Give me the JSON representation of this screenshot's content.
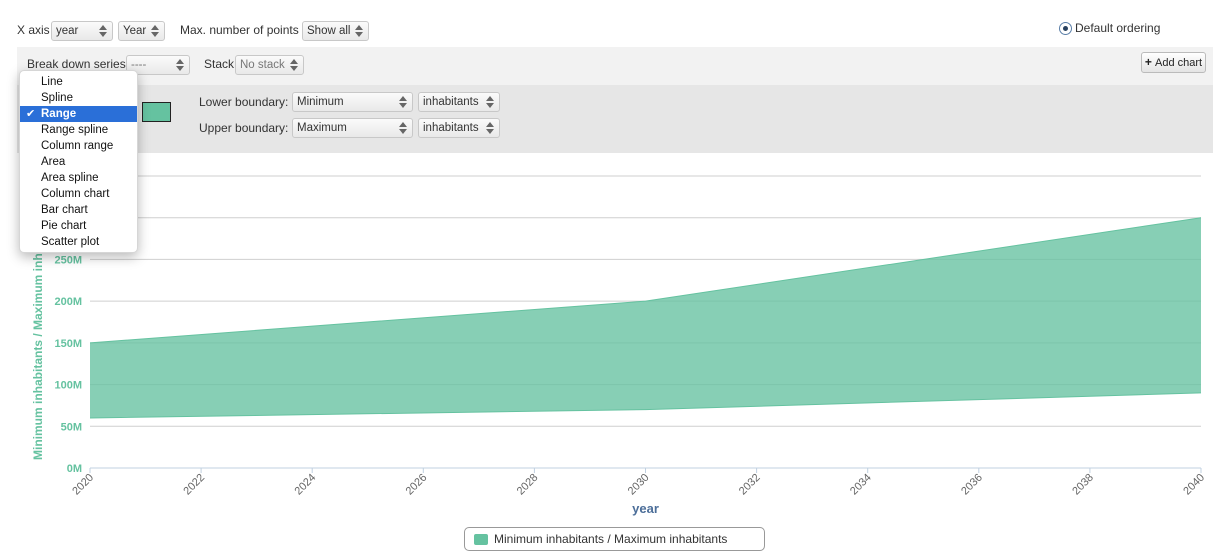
{
  "controls": {
    "x_axis_label": "X axis",
    "x_axis_value": "year",
    "x_axis_unit": "Year",
    "max_points_label": "Max. number of points",
    "max_points_value": "Show all",
    "default_ordering_label": "Default ordering",
    "break_down_label": "Break down series",
    "break_down_value": "----",
    "stack_label": "Stack",
    "stack_value": "No stack",
    "add_chart_label": "Add chart",
    "lower_boundary_label": "Lower boundary:",
    "lower_boundary_value": "Minimum",
    "lower_boundary_unit": "inhabitants",
    "upper_boundary_label": "Upper boundary:",
    "upper_boundary_value": "Maximum",
    "upper_boundary_unit": "inhabitants"
  },
  "chart_type_menu": {
    "items": [
      "Line",
      "Spline",
      "Range",
      "Range spline",
      "Column range",
      "Area",
      "Area spline",
      "Column chart",
      "Bar chart",
      "Pie chart",
      "Scatter plot"
    ],
    "selected": "Range"
  },
  "colors": {
    "series": "#65c2a0",
    "axis_title": "#65c2a0",
    "x_axis_title": "#4c6e99"
  },
  "chart_data": {
    "type": "area",
    "subtype": "range",
    "xlabel": "year",
    "ylabel": "Minimum inhabitants / Maximum inhabitants",
    "x": [
      2020,
      2030,
      2040
    ],
    "series": [
      {
        "name": "Minimum inhabitants / Maximum inhabitants",
        "low": [
          60000000,
          70000000,
          90000000
        ],
        "high": [
          150000000,
          200000000,
          300000000
        ]
      }
    ],
    "xlim": [
      2020,
      2040
    ],
    "ylim": [
      0,
      350000000
    ],
    "x_ticks": [
      "2020",
      "2022",
      "2024",
      "2026",
      "2028",
      "2030",
      "2032",
      "2034",
      "2036",
      "2038",
      "2040"
    ],
    "y_ticks": [
      "0M",
      "50M",
      "100M",
      "150M",
      "200M",
      "250M"
    ],
    "grid": "horizontal",
    "legend_position": "bottom-center"
  }
}
